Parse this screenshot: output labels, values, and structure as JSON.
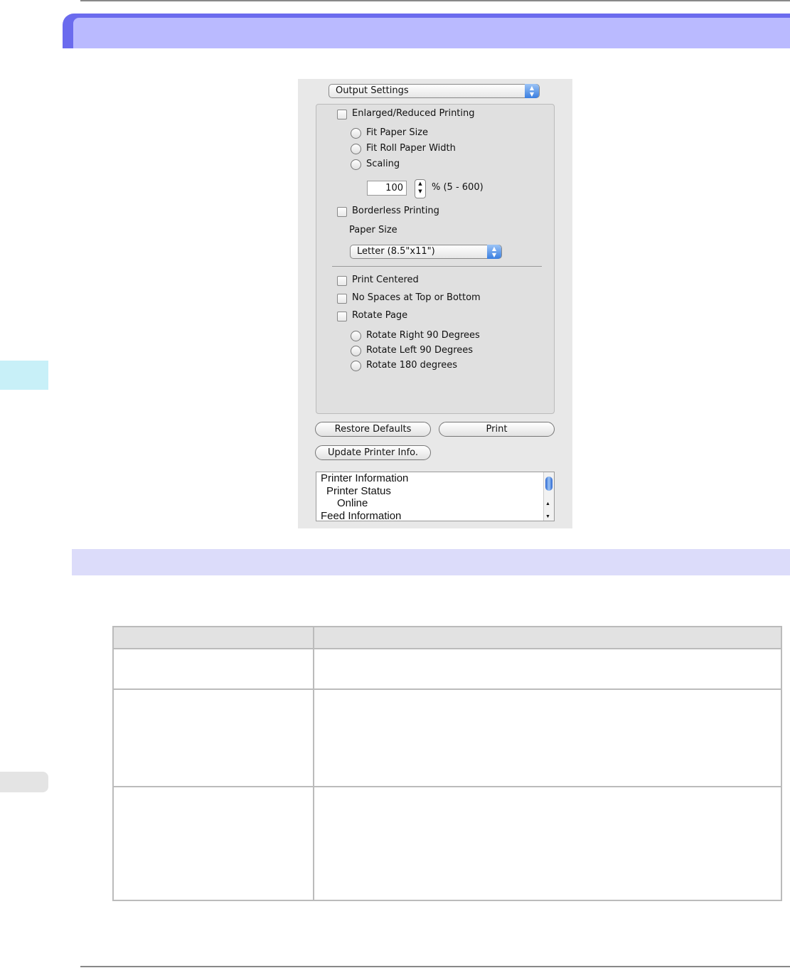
{
  "dialog": {
    "panel_popup": "Output Settings",
    "enlarged_reduced": "Enlarged/Reduced Printing",
    "fit_paper_size": "Fit Paper Size",
    "fit_roll_width": "Fit Roll Paper Width",
    "scaling": "Scaling",
    "scaling_value": "100",
    "scaling_range": "% (5 - 600)",
    "borderless": "Borderless Printing",
    "paper_size_label": "Paper Size",
    "paper_size_value": "Letter (8.5\"x11\")",
    "print_centered": "Print Centered",
    "no_spaces": "No Spaces at Top or Bottom",
    "rotate_page": "Rotate Page",
    "rotate_right": "Rotate Right 90 Degrees",
    "rotate_left": "Rotate Left 90 Degrees",
    "rotate_180": "Rotate 180 degrees",
    "restore_defaults": "Restore Defaults",
    "print": "Print",
    "update_info": "Update Printer Info.",
    "info_list": [
      "Printer Information",
      "Printer Status",
      "Online",
      "Feed Information"
    ]
  }
}
